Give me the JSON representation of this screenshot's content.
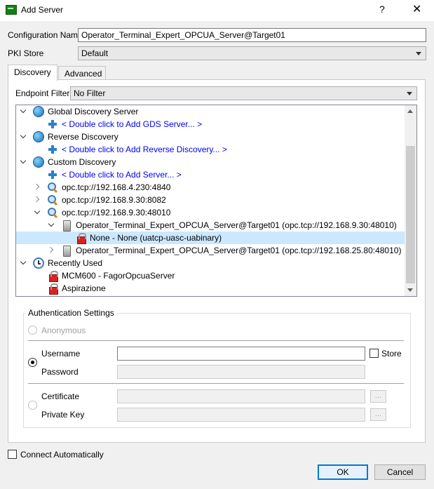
{
  "window": {
    "title": "Add Server",
    "help": "?",
    "close": "✕"
  },
  "form": {
    "config_name_label": "Configuration Name",
    "config_name_value": "Operator_Terminal_Expert_OPCUA_Server@Target01",
    "pki_store_label": "PKI Store",
    "pki_store_value": "Default"
  },
  "tabs": [
    {
      "label": "Discovery",
      "active": true
    },
    {
      "label": "Advanced",
      "active": false
    }
  ],
  "discovery": {
    "endpoint_filter_label": "Endpoint Filter:",
    "endpoint_filter_value": "No Filter",
    "tree": [
      {
        "label": "Global Discovery Server",
        "icon": "globe-icon",
        "expander": "down"
      },
      {
        "label": "< Double click to Add GDS Server... >",
        "icon": "plus-icon",
        "link": true
      },
      {
        "label": "Reverse Discovery",
        "icon": "globe-icon",
        "expander": "down"
      },
      {
        "label": "< Double click to Add Reverse Discovery... >",
        "icon": "plus-icon",
        "link": true
      },
      {
        "label": "Custom Discovery",
        "icon": "globe-icon",
        "expander": "down"
      },
      {
        "label": "< Double click to Add Server... >",
        "icon": "plus-icon",
        "link": true
      },
      {
        "label": "opc.tcp://192.168.4.230:4840",
        "icon": "magnifier-icon",
        "expander": "right"
      },
      {
        "label": "opc.tcp://192.168.9.30:8082",
        "icon": "magnifier-icon",
        "expander": "right"
      },
      {
        "label": "opc.tcp://192.168.9.30:48010",
        "icon": "magnifier-icon",
        "expander": "down"
      },
      {
        "label": "Operator_Terminal_Expert_OPCUA_Server@Target01 (opc.tcp://192.168.9.30:48010)",
        "icon": "server-icon",
        "expander": "down"
      },
      {
        "label": "None - None (uatcp-uasc-uabinary)",
        "icon": "lock-icon",
        "selected": true
      },
      {
        "label": "Operator_Terminal_Expert_OPCUA_Server@Target01 (opc.tcp://192.168.25.80:48010)",
        "icon": "server-icon",
        "expander": "right"
      },
      {
        "label": "Recently Used",
        "icon": "clock-icon",
        "expander": "down"
      },
      {
        "label": "MCM600 - FagorOpcuaServer",
        "icon": "lock-icon"
      },
      {
        "label": "Aspirazione",
        "icon": "lock-icon"
      }
    ]
  },
  "auth": {
    "title": "Authentication Settings",
    "anonymous_label": "Anonymous",
    "username_label": "Username",
    "username_value": "",
    "store_label": "Store",
    "password_label": "Password",
    "certificate_label": "Certificate",
    "private_key_label": "Private Key",
    "browse_label": "..."
  },
  "footer": {
    "connect_auto_label": "Connect Automatically",
    "ok_label": "OK",
    "cancel_label": "Cancel"
  },
  "colors": {
    "link": "#0000ee",
    "selection": "#cce8ff",
    "default_button_border": "#0078d7"
  }
}
